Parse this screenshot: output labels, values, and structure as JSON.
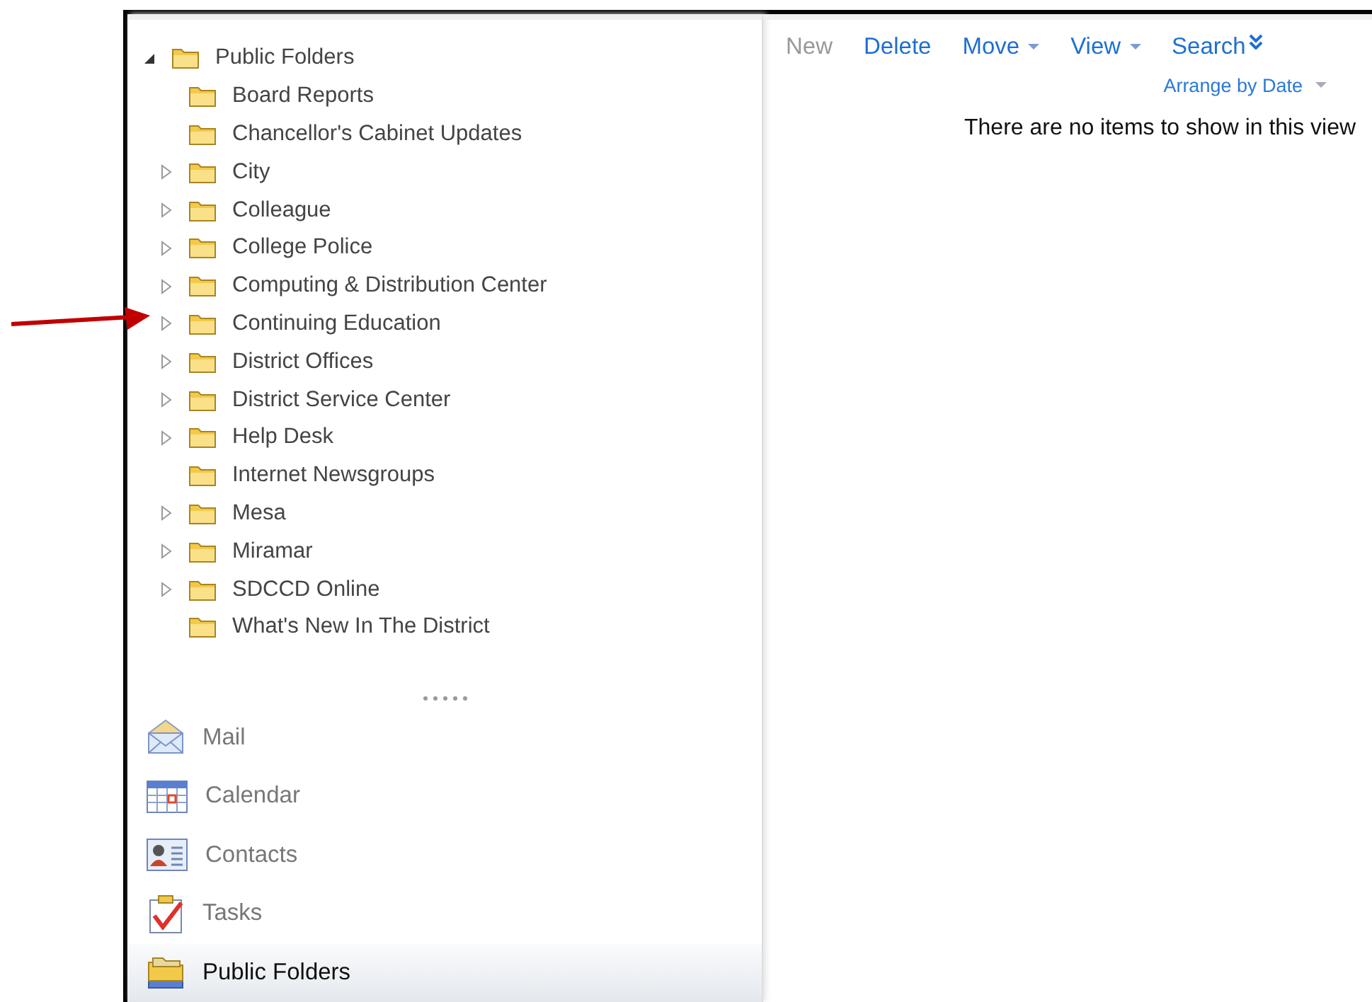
{
  "folder_tree": {
    "label": "Public Folders",
    "expanded": true,
    "children": [
      {
        "label": "Board Reports",
        "expandable": false
      },
      {
        "label": "Chancellor's Cabinet Updates",
        "expandable": false
      },
      {
        "label": "City",
        "expandable": true
      },
      {
        "label": "Colleague",
        "expandable": true
      },
      {
        "label": "College Police",
        "expandable": true
      },
      {
        "label": "Computing & Distribution Center",
        "expandable": true
      },
      {
        "label": "Continuing Education",
        "expandable": true
      },
      {
        "label": "District Offices",
        "expandable": true
      },
      {
        "label": "District Service Center",
        "expandable": true
      },
      {
        "label": "Help Desk",
        "expandable": true
      },
      {
        "label": "Internet Newsgroups",
        "expandable": false
      },
      {
        "label": "Mesa",
        "expandable": true
      },
      {
        "label": "Miramar",
        "expandable": true
      },
      {
        "label": "SDCCD Online",
        "expandable": true
      },
      {
        "label": "What's New In The District",
        "expandable": false
      }
    ]
  },
  "nav_items": [
    {
      "kind": "mail",
      "label": "Mail",
      "selected": false
    },
    {
      "kind": "calendar",
      "label": "Calendar",
      "selected": false
    },
    {
      "kind": "contacts",
      "label": "Contacts",
      "selected": false
    },
    {
      "kind": "tasks",
      "label": "Tasks",
      "selected": false
    },
    {
      "kind": "folders",
      "label": "Public Folders",
      "selected": true
    }
  ],
  "toolbar": [
    {
      "label": "New",
      "disabled": true,
      "kind": "plain"
    },
    {
      "label": "Delete",
      "disabled": false,
      "kind": "plain"
    },
    {
      "label": "Move",
      "disabled": false,
      "kind": "dropdown"
    },
    {
      "label": "View",
      "disabled": false,
      "kind": "dropdown"
    },
    {
      "label": "Search",
      "disabled": false,
      "kind": "expand"
    }
  ],
  "arrange_by": "Arrange by Date",
  "empty_message": "There are no items to show in this view"
}
